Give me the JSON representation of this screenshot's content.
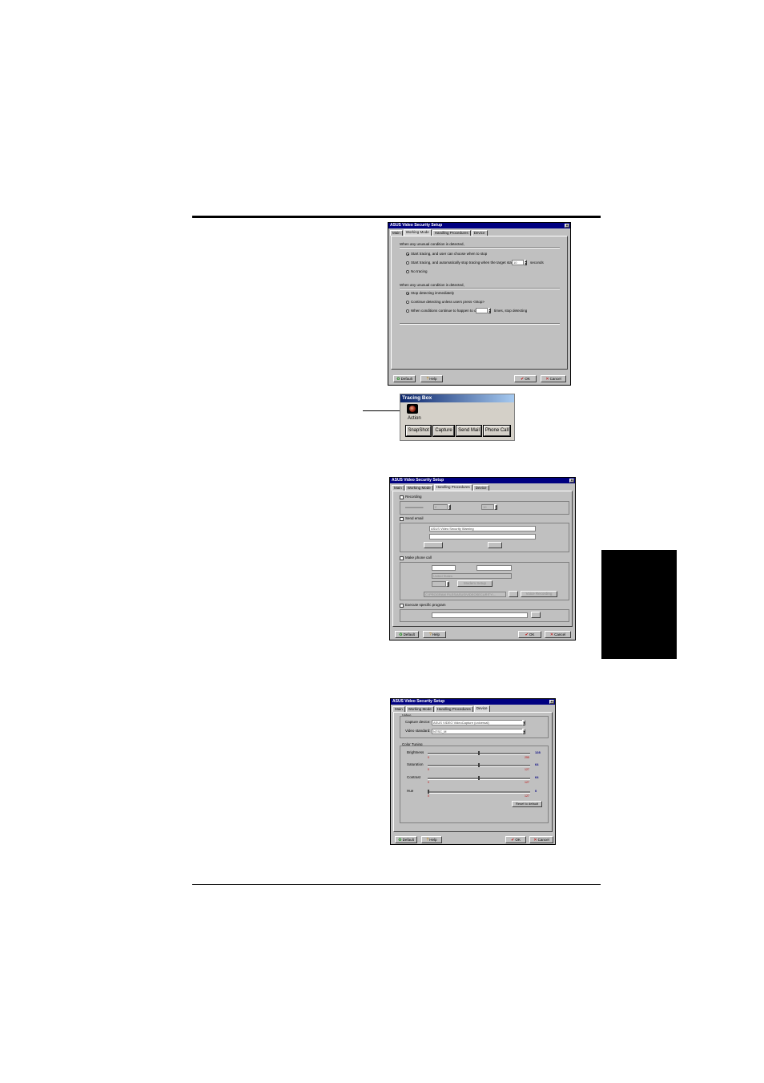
{
  "dialog1": {
    "title": "ASUS Video Security Setup",
    "tabs": [
      "Main",
      "Working Mode",
      "Handling Procedures",
      "Device"
    ],
    "active_tab": 1,
    "group1_label": "When any unusual condition is detected,",
    "options1": [
      "Start tracing, and user can choose when to stop",
      "Start tracing, and automatically stop tracing when the target stays still for",
      "No tracing"
    ],
    "seconds_value": "10",
    "seconds_label": "seconds",
    "group2_label": "When any unusual condition is detected,",
    "options2": [
      "Stop detecting immediately",
      "Continue detecting unless users press <Stop>",
      "When conditions continue to happen to over"
    ],
    "times_value": "",
    "times_label": "times, stop detecting",
    "btn_default": "Default",
    "btn_help": "Help",
    "btn_ok": "OK",
    "btn_cancel": "Cancel"
  },
  "tracing_box": {
    "title": "Tracing Box",
    "action_label": "Action",
    "buttons": [
      "SnapShot",
      "Capture",
      "Send Mail",
      "Phone Call"
    ]
  },
  "dialog2": {
    "title": "ASUS Video Security Setup",
    "tabs": [
      "Main",
      "Working Mode",
      "Handling Procedures",
      "Device"
    ],
    "active_tab": 2,
    "recording_label": "Recording",
    "recording_value1": "2",
    "recording_value2": "10",
    "send_email_label": "Send email",
    "email_subject": "ASUS Video Security Warning",
    "phone_label": "Make phone call",
    "country": "United States",
    "modem_setup": "Modem Setup",
    "voice_file": "C:\\PROGRAM FILES\\ASUS\\VIDEOSECURITY\\...",
    "record_btn": "Voice Recording",
    "execute_label": "Execute specific program",
    "btn_default": "Default",
    "btn_help": "Help",
    "btn_ok": "OK",
    "btn_cancel": "Cancel"
  },
  "dialog3": {
    "title": "ASUS Video Security Setup",
    "tabs": [
      "Main",
      "Working Mode",
      "Handling Procedures",
      "Device"
    ],
    "active_tab": 3,
    "video_group": "Video",
    "capture_device_label": "Capture device:",
    "capture_device_value": "ASUS VIDEO VideoCapture (universal)",
    "video_standard_label": "Video standard:",
    "video_standard_value": "NTSC_M",
    "color_group": "Color Tuning",
    "sliders": [
      {
        "label": "Brightness",
        "value": "128",
        "min": "0",
        "max": "255",
        "fraction": 0.5
      },
      {
        "label": "Saturation",
        "value": "64",
        "min": "0",
        "max": "127",
        "fraction": 0.5
      },
      {
        "label": "Contrast",
        "value": "64",
        "min": "0",
        "max": "127",
        "fraction": 0.5
      },
      {
        "label": "Hue",
        "value": "0",
        "min": "0",
        "max": "127",
        "fraction": 0.0
      }
    ],
    "reset_btn": "Reset to default",
    "btn_default": "Default",
    "btn_help": "Help",
    "btn_ok": "OK",
    "btn_cancel": "Cancel"
  }
}
